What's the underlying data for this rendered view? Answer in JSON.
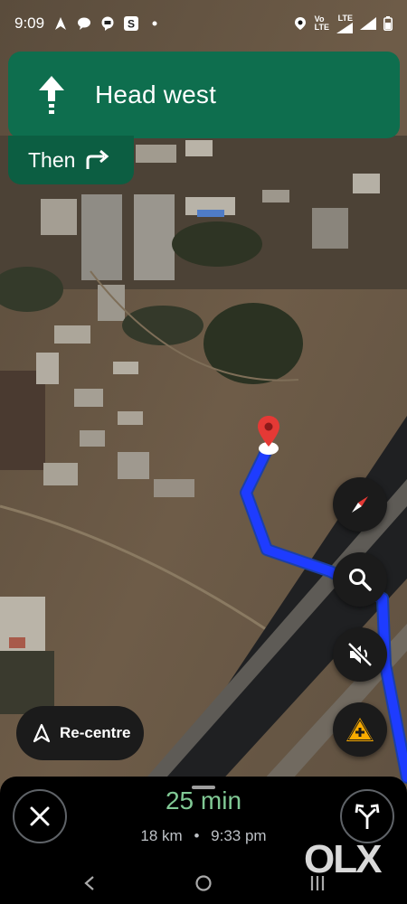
{
  "status_bar": {
    "time": "9:09",
    "lte_label_1": "Vo",
    "lte_label_2": "LTE",
    "lte_label_3": "LTE"
  },
  "navigation": {
    "instruction": "Head west",
    "then_label": "Then"
  },
  "buttons": {
    "recentre_label": "Re-centre"
  },
  "trip": {
    "duration": "25 min",
    "distance": "18 km",
    "separator": "•",
    "arrival": "9:33 pm"
  },
  "watermark": "OLX",
  "colors": {
    "banner": "#0e6e4e",
    "then_panel": "#0c5e42",
    "route": "#1a33ff",
    "eta_green": "#81c995",
    "pin_red": "#e53935",
    "warning_yellow": "#f9ab00"
  }
}
